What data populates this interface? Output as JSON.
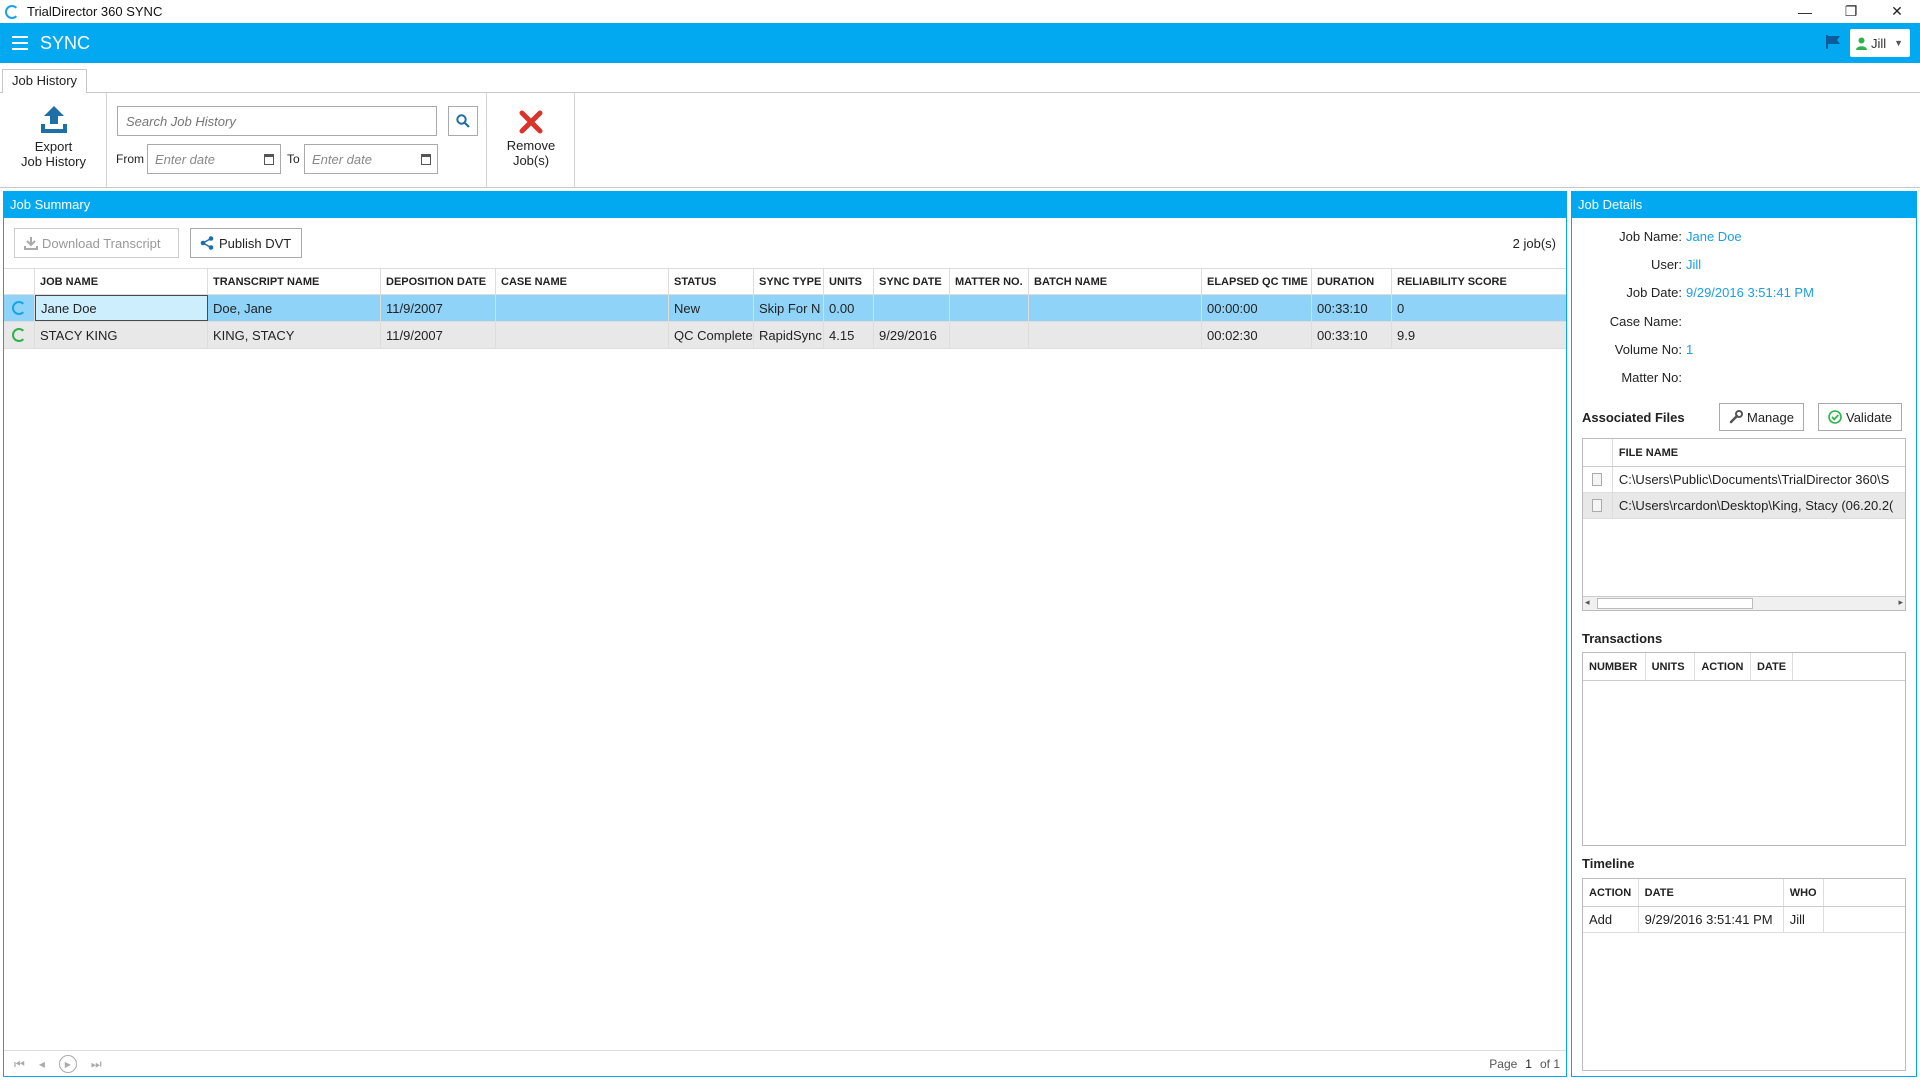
{
  "window": {
    "title": "TrialDirector 360 SYNC",
    "minimize": "—",
    "restore": "❐",
    "close": "✕"
  },
  "appbar": {
    "name": "SYNC",
    "user": "Jill"
  },
  "tabs": [
    {
      "label": "Job History"
    }
  ],
  "ribbon": {
    "export_line1": "Export",
    "export_line2": "Job History",
    "search_placeholder": "Search Job History",
    "from_label": "From",
    "to_label": "To",
    "date_placeholder": "Enter date",
    "remove_line1": "Remove",
    "remove_line2": "Job(s)"
  },
  "job_summary": {
    "title": "Job Summary",
    "download_label": "Download Transcript",
    "publish_label": "Publish DVT",
    "job_count": "2 job(s)",
    "columns": [
      "JOB NAME",
      "TRANSCRIPT NAME",
      "DEPOSITION DATE",
      "CASE NAME",
      "STATUS",
      "SYNC TYPE",
      "UNITS",
      "SYNC DATE",
      "MATTER NO.",
      "BATCH NAME",
      "ELAPSED QC TIME",
      "DURATION",
      "RELIABILITY SCORE"
    ],
    "rows": [
      {
        "job_name": "Jane Doe",
        "transcript": "Doe, Jane",
        "depo_date": "11/9/2007",
        "case": "",
        "status": "New",
        "sync_type": "Skip For N",
        "units": "0.00",
        "sync_date": "",
        "matter": "",
        "batch": "",
        "elapsed": "00:00:00",
        "duration": "00:33:10",
        "score": "0"
      },
      {
        "job_name": "STACY KING",
        "transcript": "KING, STACY",
        "depo_date": "11/9/2007",
        "case": "",
        "status": "QC Complete",
        "sync_type": "RapidSync",
        "units": "4.15",
        "sync_date": "9/29/2016",
        "matter": "",
        "batch": "",
        "elapsed": "00:02:30",
        "duration": "00:33:10",
        "score": "9.9"
      }
    ],
    "pager": {
      "page_label": "Page",
      "page": "1",
      "of_label": "of 1"
    }
  },
  "job_details": {
    "title": "Job Details",
    "fields": [
      {
        "label": "Job Name:",
        "value": "Jane Doe"
      },
      {
        "label": "User:",
        "value": "Jill"
      },
      {
        "label": "Job Date:",
        "value": "9/29/2016 3:51:41 PM"
      },
      {
        "label": "Case Name:",
        "value": ""
      },
      {
        "label": "Volume No:",
        "value": "1"
      },
      {
        "label": "Matter No:",
        "value": ""
      }
    ],
    "associated_files_title": "Associated Files",
    "manage_label": "Manage",
    "validate_label": "Validate",
    "files_header": "FILE NAME",
    "files": [
      "C:\\Users\\Public\\Documents\\TrialDirector 360\\S",
      "C:\\Users\\rcardon\\Desktop\\King, Stacy (06.20.2("
    ],
    "transactions_title": "Transactions",
    "transactions_columns": [
      "NUMBER",
      "UNITS",
      "ACTION",
      "DATE"
    ],
    "timeline_title": "Timeline",
    "timeline_columns": [
      "ACTION",
      "DATE",
      "WHO"
    ],
    "timeline_rows": [
      {
        "action": "Add",
        "date": "9/29/2016 3:51:41 PM",
        "who": "Jill"
      }
    ]
  }
}
